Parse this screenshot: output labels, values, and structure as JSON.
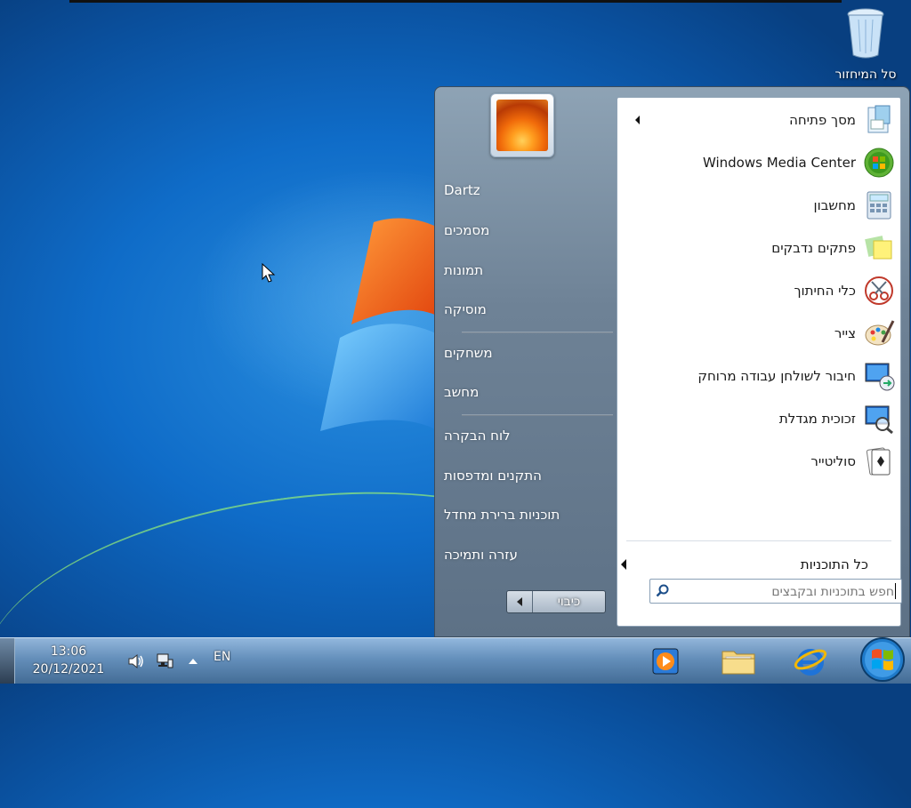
{
  "desktop": {
    "recycle_bin_label": "סל המיחזור"
  },
  "start_menu": {
    "programs": [
      {
        "label": "מסך פתיחה",
        "icon": "getting-started-icon",
        "has_submenu": true
      },
      {
        "label": "Windows Media Center",
        "icon": "media-center-icon",
        "has_submenu": false
      },
      {
        "label": "מחשבון",
        "icon": "calculator-icon",
        "has_submenu": false
      },
      {
        "label": "פתקים נדבקים",
        "icon": "sticky-notes-icon",
        "has_submenu": false
      },
      {
        "label": "כלי החיתוך",
        "icon": "snipping-tool-icon",
        "has_submenu": false
      },
      {
        "label": "צייר",
        "icon": "paint-icon",
        "has_submenu": false
      },
      {
        "label": "חיבור לשולחן עבודה מרוחק",
        "icon": "remote-desktop-icon",
        "has_submenu": false
      },
      {
        "label": "זכוכית מגדלת",
        "icon": "magnifier-icon",
        "has_submenu": false
      },
      {
        "label": "סוליטייר",
        "icon": "solitaire-icon",
        "has_submenu": false
      }
    ],
    "all_programs_label": "כל התוכניות",
    "search": {
      "placeholder": "חפש בתוכניות ובקבצים",
      "value": ""
    },
    "places": [
      {
        "label": "Dartz"
      },
      {
        "label": "מסמכים"
      },
      {
        "label": "תמונות"
      },
      {
        "label": "מוסיקה"
      },
      {
        "label": "משחקים"
      },
      {
        "label": "מחשב"
      },
      {
        "label": "לוח הבקרה"
      },
      {
        "label": "התקנים ומדפסות"
      },
      {
        "label": "תוכניות ברירת מחדל"
      },
      {
        "label": "עזרה ותמיכה"
      }
    ],
    "shutdown_label": "כיבוי"
  },
  "taskbar": {
    "time": "13:06",
    "date": "20/12/2021",
    "language": "EN",
    "pinned": [
      "media-player-icon",
      "explorer-folder-icon",
      "internet-explorer-icon"
    ]
  }
}
